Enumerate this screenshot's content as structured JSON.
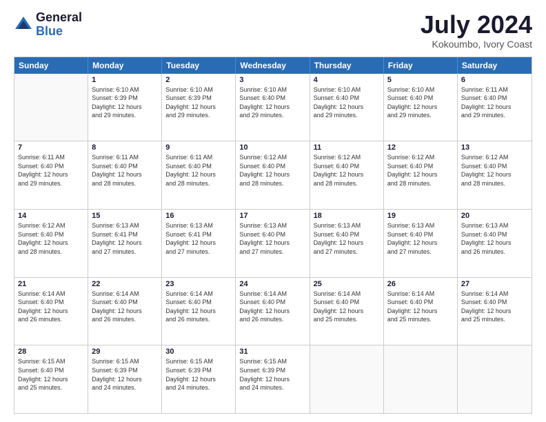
{
  "logo": {
    "general": "General",
    "blue": "Blue"
  },
  "title": "July 2024",
  "location": "Kokoumbo, Ivory Coast",
  "days_of_week": [
    "Sunday",
    "Monday",
    "Tuesday",
    "Wednesday",
    "Thursday",
    "Friday",
    "Saturday"
  ],
  "weeks": [
    [
      {
        "day": "",
        "empty": true
      },
      {
        "day": "1",
        "sunrise": "6:10 AM",
        "sunset": "6:39 PM",
        "daylight": "12 hours and 29 minutes."
      },
      {
        "day": "2",
        "sunrise": "6:10 AM",
        "sunset": "6:39 PM",
        "daylight": "12 hours and 29 minutes."
      },
      {
        "day": "3",
        "sunrise": "6:10 AM",
        "sunset": "6:40 PM",
        "daylight": "12 hours and 29 minutes."
      },
      {
        "day": "4",
        "sunrise": "6:10 AM",
        "sunset": "6:40 PM",
        "daylight": "12 hours and 29 minutes."
      },
      {
        "day": "5",
        "sunrise": "6:10 AM",
        "sunset": "6:40 PM",
        "daylight": "12 hours and 29 minutes."
      },
      {
        "day": "6",
        "sunrise": "6:11 AM",
        "sunset": "6:40 PM",
        "daylight": "12 hours and 29 minutes."
      }
    ],
    [
      {
        "day": "7",
        "sunrise": "6:11 AM",
        "sunset": "6:40 PM",
        "daylight": "12 hours and 29 minutes."
      },
      {
        "day": "8",
        "sunrise": "6:11 AM",
        "sunset": "6:40 PM",
        "daylight": "12 hours and 28 minutes."
      },
      {
        "day": "9",
        "sunrise": "6:11 AM",
        "sunset": "6:40 PM",
        "daylight": "12 hours and 28 minutes."
      },
      {
        "day": "10",
        "sunrise": "6:12 AM",
        "sunset": "6:40 PM",
        "daylight": "12 hours and 28 minutes."
      },
      {
        "day": "11",
        "sunrise": "6:12 AM",
        "sunset": "6:40 PM",
        "daylight": "12 hours and 28 minutes."
      },
      {
        "day": "12",
        "sunrise": "6:12 AM",
        "sunset": "6:40 PM",
        "daylight": "12 hours and 28 minutes."
      },
      {
        "day": "13",
        "sunrise": "6:12 AM",
        "sunset": "6:40 PM",
        "daylight": "12 hours and 28 minutes."
      }
    ],
    [
      {
        "day": "14",
        "sunrise": "6:12 AM",
        "sunset": "6:40 PM",
        "daylight": "12 hours and 28 minutes."
      },
      {
        "day": "15",
        "sunrise": "6:13 AM",
        "sunset": "6:41 PM",
        "daylight": "12 hours and 27 minutes."
      },
      {
        "day": "16",
        "sunrise": "6:13 AM",
        "sunset": "6:41 PM",
        "daylight": "12 hours and 27 minutes."
      },
      {
        "day": "17",
        "sunrise": "6:13 AM",
        "sunset": "6:40 PM",
        "daylight": "12 hours and 27 minutes."
      },
      {
        "day": "18",
        "sunrise": "6:13 AM",
        "sunset": "6:40 PM",
        "daylight": "12 hours and 27 minutes."
      },
      {
        "day": "19",
        "sunrise": "6:13 AM",
        "sunset": "6:40 PM",
        "daylight": "12 hours and 27 minutes."
      },
      {
        "day": "20",
        "sunrise": "6:13 AM",
        "sunset": "6:40 PM",
        "daylight": "12 hours and 26 minutes."
      }
    ],
    [
      {
        "day": "21",
        "sunrise": "6:14 AM",
        "sunset": "6:40 PM",
        "daylight": "12 hours and 26 minutes."
      },
      {
        "day": "22",
        "sunrise": "6:14 AM",
        "sunset": "6:40 PM",
        "daylight": "12 hours and 26 minutes."
      },
      {
        "day": "23",
        "sunrise": "6:14 AM",
        "sunset": "6:40 PM",
        "daylight": "12 hours and 26 minutes."
      },
      {
        "day": "24",
        "sunrise": "6:14 AM",
        "sunset": "6:40 PM",
        "daylight": "12 hours and 26 minutes."
      },
      {
        "day": "25",
        "sunrise": "6:14 AM",
        "sunset": "6:40 PM",
        "daylight": "12 hours and 25 minutes."
      },
      {
        "day": "26",
        "sunrise": "6:14 AM",
        "sunset": "6:40 PM",
        "daylight": "12 hours and 25 minutes."
      },
      {
        "day": "27",
        "sunrise": "6:14 AM",
        "sunset": "6:40 PM",
        "daylight": "12 hours and 25 minutes."
      }
    ],
    [
      {
        "day": "28",
        "sunrise": "6:15 AM",
        "sunset": "6:40 PM",
        "daylight": "12 hours and 25 minutes."
      },
      {
        "day": "29",
        "sunrise": "6:15 AM",
        "sunset": "6:39 PM",
        "daylight": "12 hours and 24 minutes."
      },
      {
        "day": "30",
        "sunrise": "6:15 AM",
        "sunset": "6:39 PM",
        "daylight": "12 hours and 24 minutes."
      },
      {
        "day": "31",
        "sunrise": "6:15 AM",
        "sunset": "6:39 PM",
        "daylight": "12 hours and 24 minutes."
      },
      {
        "day": "",
        "empty": true
      },
      {
        "day": "",
        "empty": true
      },
      {
        "day": "",
        "empty": true
      }
    ]
  ]
}
